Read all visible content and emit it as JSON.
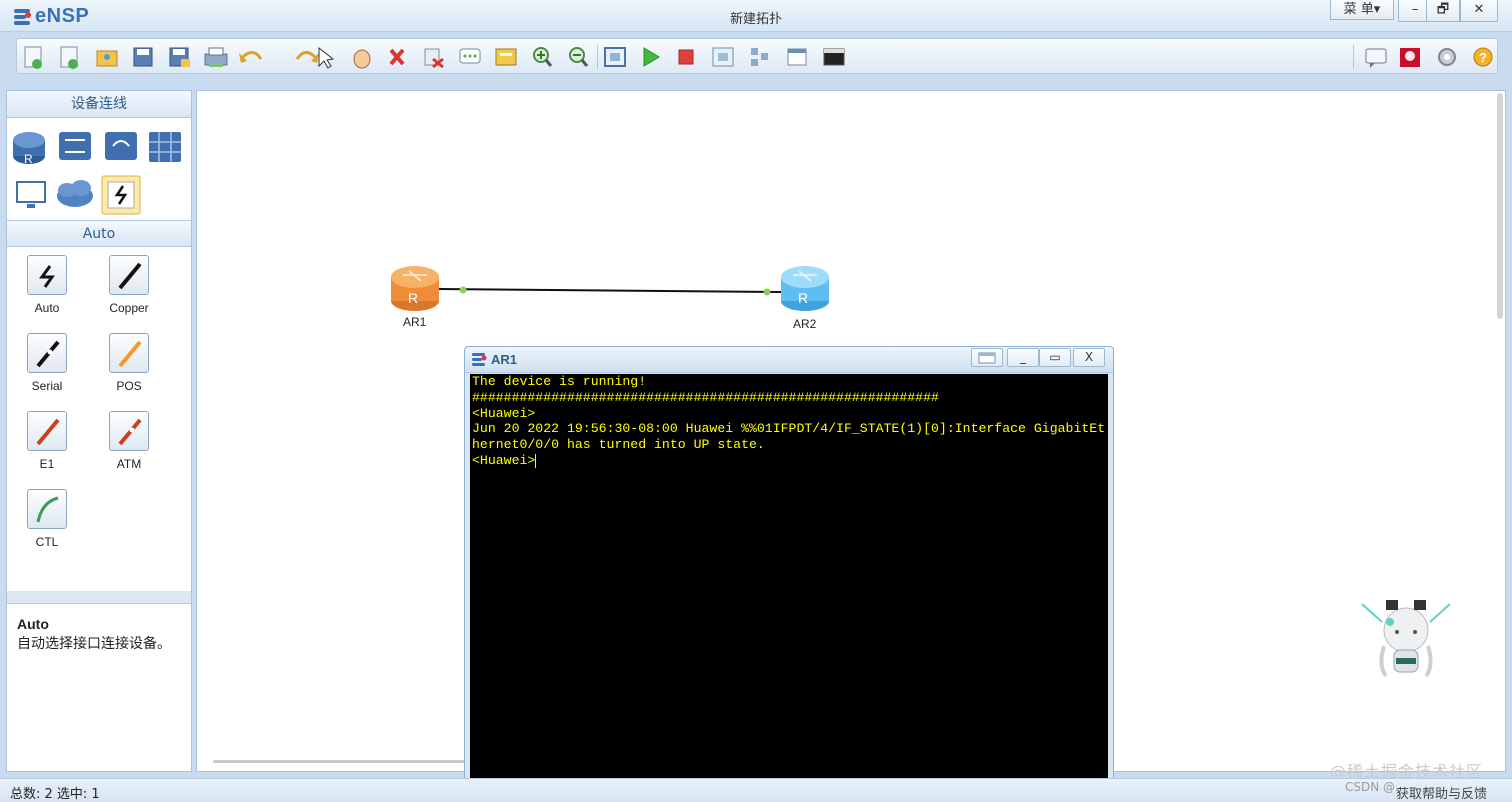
{
  "app": {
    "name": "eNSP",
    "window_title": "新建拓扑"
  },
  "window_controls": {
    "menu": "菜 单▾",
    "minimize": "–",
    "restore": "🗗",
    "close": "✕"
  },
  "toolbar": {
    "items": [
      "new-topo",
      "new-lab",
      "open",
      "save",
      "save-as",
      "print",
      "undo",
      "redo",
      "select",
      "pan",
      "delete",
      "delete-link",
      "text",
      "label",
      "zoom-in",
      "zoom-out",
      "fit",
      "start",
      "stop",
      "capture",
      "topology",
      "panel",
      "console"
    ],
    "right_items": [
      "chat",
      "huawei",
      "settings",
      "help"
    ]
  },
  "left_panel": {
    "devices_header": "设备连线",
    "devices": [
      "router",
      "switch",
      "wireless",
      "firewall",
      "pc",
      "cloud",
      "connection"
    ],
    "connections_header": "Auto",
    "connections": [
      {
        "label": "Auto",
        "icon": "auto-link-icon"
      },
      {
        "label": "Copper",
        "icon": "copper-cable-icon"
      },
      {
        "label": "Serial",
        "icon": "serial-cable-icon"
      },
      {
        "label": "POS",
        "icon": "pos-cable-icon"
      },
      {
        "label": "E1",
        "icon": "e1-cable-icon"
      },
      {
        "label": "ATM",
        "icon": "atm-cable-icon"
      },
      {
        "label": "CTL",
        "icon": "ctl-cable-icon"
      }
    ],
    "description": {
      "title": "Auto",
      "text": "自动选择接口连接设备。"
    }
  },
  "canvas": {
    "devices": [
      {
        "name": "AR1",
        "color": "#f39a48"
      },
      {
        "name": "AR2",
        "color": "#5fbdf2"
      }
    ]
  },
  "console": {
    "title": "AR1",
    "lines": [
      "The device is running!",
      "###########################################################",
      "<Huawei>",
      "Jun 20 2022 19:56:30-08:00 Huawei %%01IFPDT/4/IF_STATE(1)[0]:Interface GigabitEt",
      "hernet0/0/0 has turned into UP state.",
      "<Huawei>"
    ],
    "controls": {
      "minimize": "_",
      "maximize": "▭",
      "close": "X"
    }
  },
  "statusbar": {
    "text": "总数: 2  选中: 1",
    "right": "获取帮助与反馈"
  },
  "watermark": {
    "main": "@稀土掘金技术社区",
    "sub": "CSDN @..."
  }
}
